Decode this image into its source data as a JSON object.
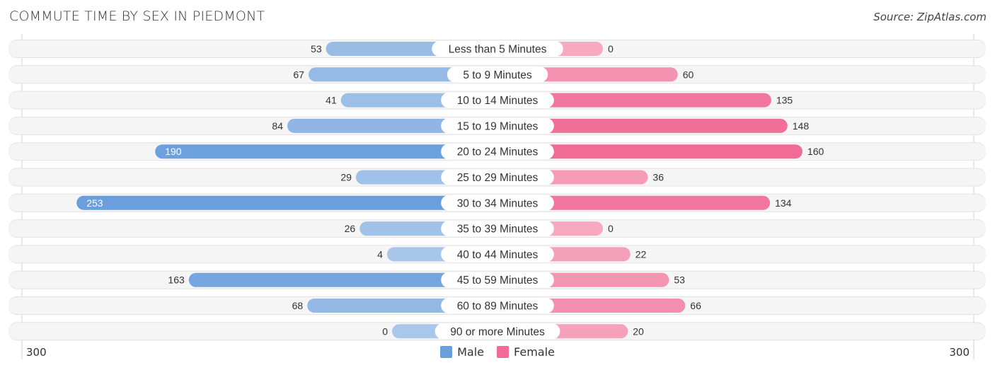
{
  "chart_data": {
    "type": "bar",
    "orientation": "horizontal-diverging",
    "title": "COMMUTE TIME BY SEX IN PIEDMONT",
    "source": "Source: ZipAtlas.com",
    "categories": [
      "Less than 5 Minutes",
      "5 to 9 Minutes",
      "10 to 14 Minutes",
      "15 to 19 Minutes",
      "20 to 24 Minutes",
      "25 to 29 Minutes",
      "30 to 34 Minutes",
      "35 to 39 Minutes",
      "40 to 44 Minutes",
      "45 to 59 Minutes",
      "60 to 89 Minutes",
      "90 or more Minutes"
    ],
    "series": [
      {
        "name": "Male",
        "color": "#6a9fdc",
        "light_color": "#a9c7ea",
        "values": [
          53,
          67,
          41,
          84,
          190,
          29,
          253,
          26,
          4,
          163,
          68,
          0
        ]
      },
      {
        "name": "Female",
        "color": "#f06b96",
        "light_color": "#f6a9c1",
        "values": [
          0,
          60,
          135,
          148,
          160,
          36,
          134,
          0,
          22,
          53,
          66,
          20
        ]
      }
    ],
    "axis": {
      "left_label": "300",
      "right_label": "300",
      "max": 300
    },
    "legend": {
      "position": "bottom-center",
      "entries": [
        "Male",
        "Female"
      ]
    },
    "inside_label_threshold": 180
  }
}
